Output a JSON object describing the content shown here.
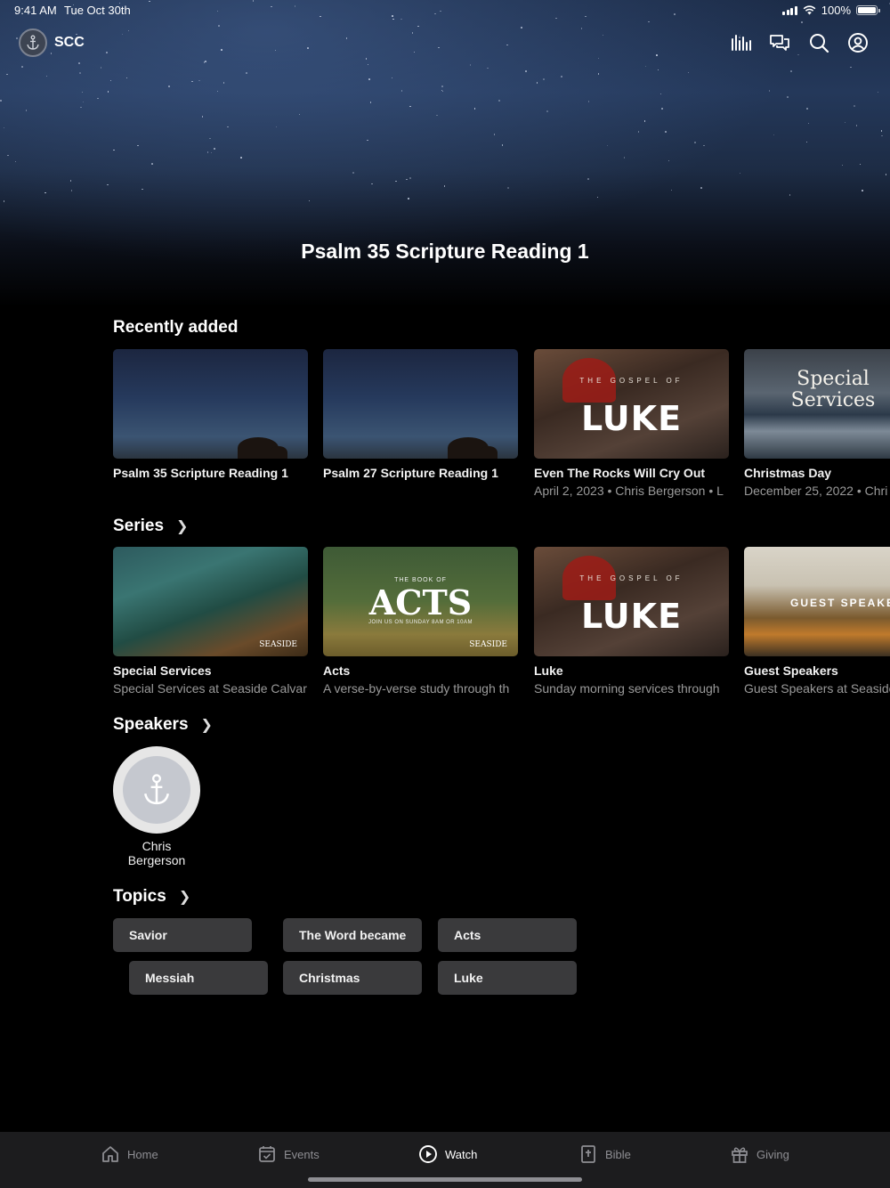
{
  "status": {
    "time": "9:41 AM",
    "date": "Tue Oct 30th",
    "battery": "100%"
  },
  "header": {
    "brand": "SCC"
  },
  "hero": {
    "title": "Psalm 35 Scripture Reading 1"
  },
  "recent": {
    "title": "Recently added",
    "items": [
      {
        "title": "Psalm 35 Scripture Reading 1",
        "subtitle": ""
      },
      {
        "title": "Psalm 27 Scripture Reading 1",
        "subtitle": ""
      },
      {
        "title": "Even The Rocks Will Cry Out",
        "subtitle": "April 2, 2023 • Chris Bergerson • L",
        "art_small": "THE GOSPEL OF",
        "art_big": "LUKE"
      },
      {
        "title": "Christmas Day",
        "subtitle": "December 25, 2022 • Chri",
        "art_big": "Special Services"
      }
    ]
  },
  "series": {
    "title": "Series",
    "items": [
      {
        "title": "Special Services",
        "subtitle": "Special Services at Seaside Calvar",
        "art_mark": "SEASIDE"
      },
      {
        "title": "Acts",
        "subtitle": "A verse-by-verse study through th",
        "art_small": "THE BOOK OF",
        "art_big": "ACTS",
        "art_sub": "JOIN US ON SUNDAY 8AM OR 10AM",
        "art_mark": "SEASIDE"
      },
      {
        "title": "Luke",
        "subtitle": "Sunday morning services through",
        "art_small": "THE GOSPEL OF",
        "art_big": "LUKE"
      },
      {
        "title": "Guest Speakers",
        "subtitle": "Guest Speakers at Seaside",
        "art_big": "GUEST SPEAKERS"
      }
    ]
  },
  "speakers": {
    "title": "Speakers",
    "items": [
      {
        "name": "Chris Bergerson"
      }
    ]
  },
  "topics": {
    "title": "Topics",
    "items": [
      "Savior",
      "The Word became",
      "Acts",
      "Messiah",
      "Christmas",
      "Luke"
    ]
  },
  "tabs": [
    {
      "label": "Home",
      "icon": "home-icon"
    },
    {
      "label": "Events",
      "icon": "calendar-icon"
    },
    {
      "label": "Watch",
      "icon": "play-icon",
      "active": true
    },
    {
      "label": "Bible",
      "icon": "bible-icon"
    },
    {
      "label": "Giving",
      "icon": "gift-icon"
    }
  ],
  "colors": {
    "background": "#000000",
    "tabbar": "#1c1c1e",
    "chip": "#3a3a3c",
    "muted": "#9a9a9a"
  }
}
